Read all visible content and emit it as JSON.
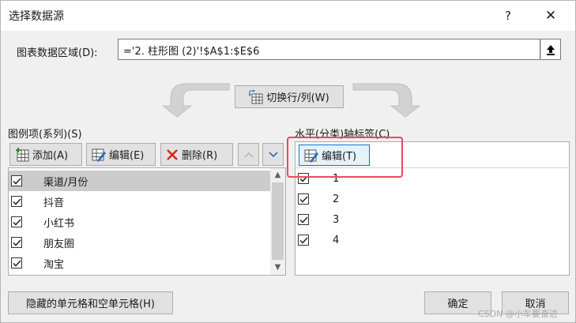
{
  "dialog": {
    "title": "选择数据源",
    "help_label": "?",
    "close_label": "✕"
  },
  "data_range": {
    "label": "图表数据区域(D):",
    "value": "='2. 柱形图 (2)'!$A$1:$E$6"
  },
  "switch_button": {
    "label": "切换行/列(W)"
  },
  "legend": {
    "label": "图例项(系列)(S)",
    "add_label": "添加(A)",
    "edit_label": "编辑(E)",
    "delete_label": "删除(R)",
    "series": [
      {
        "name": "渠道/月份",
        "checked": true,
        "selected": true
      },
      {
        "name": "抖音",
        "checked": true,
        "selected": false
      },
      {
        "name": "小红书",
        "checked": true,
        "selected": false
      },
      {
        "name": "朋友圈",
        "checked": true,
        "selected": false
      },
      {
        "name": "淘宝",
        "checked": true,
        "selected": false
      }
    ]
  },
  "axis": {
    "label": "水平(分类)轴标签(C)",
    "edit_label": "编辑(T)",
    "categories": [
      {
        "name": "1",
        "checked": true
      },
      {
        "name": "2",
        "checked": true
      },
      {
        "name": "3",
        "checked": true
      },
      {
        "name": "4",
        "checked": true
      }
    ]
  },
  "footer": {
    "hidden_cells_label": "隐藏的单元格和空单元格(H)",
    "ok_label": "确定",
    "cancel_label": "取消"
  },
  "watermark": "CSDN @小车要奋进",
  "colors": {
    "highlight": "#e84a5f",
    "selected_row": "#cccccc",
    "focus_border": "#0078d7"
  }
}
